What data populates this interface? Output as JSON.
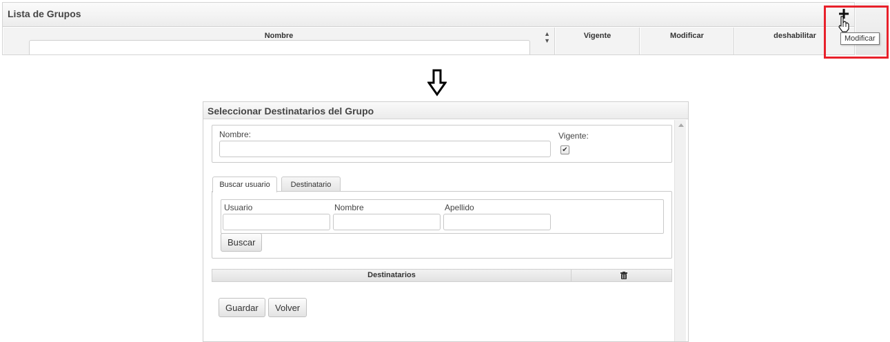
{
  "lista_grupos": {
    "title": "Lista de Grupos",
    "columns": [
      "Nombre",
      "Vigente",
      "Modificar",
      "deshabilitar"
    ],
    "add_icon": "plus-icon",
    "tooltip": "Modificar",
    "highlight_color": "#e8202a"
  },
  "arrow_icon": "down-arrow-icon",
  "dialog": {
    "title": "Seleccionar Destinatarios del Grupo",
    "nombre_label": "Nombre:",
    "nombre_value": "",
    "vigente_label": "Vigente:",
    "vigente_checked": true,
    "tabs": [
      "Buscar usuario",
      "Destinatario"
    ],
    "active_tab": "Buscar usuario",
    "search": {
      "usuario_label": "Usuario",
      "nombre_label": "Nombre",
      "apellido_label": "Apellido",
      "buscar_button": "Buscar"
    },
    "destinatarios_header": "Destinatarios",
    "delete_icon": "trash-icon",
    "guardar_button": "Guardar",
    "volver_button": "Volver"
  }
}
